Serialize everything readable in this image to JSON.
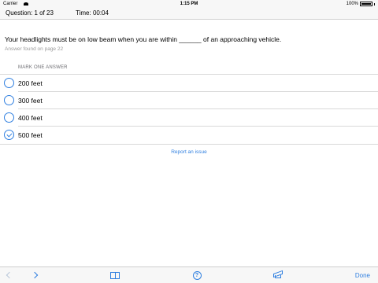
{
  "status_bar": {
    "carrier": "Carrier",
    "time": "1:15 PM",
    "battery": "100%"
  },
  "header": {
    "question_label": "Question:",
    "question_value": "1 of 23",
    "time_label": "Time:",
    "time_value": "00:04"
  },
  "question": {
    "text": "Your headlights must be on low beam when you are within ______ of an approaching vehicle.",
    "answer_found": "Answer found on page 22"
  },
  "answers": {
    "section_label": "MARK ONE ANSWER",
    "options": [
      {
        "label": "200 feet",
        "selected": false
      },
      {
        "label": "300 feet",
        "selected": false
      },
      {
        "label": "400 feet",
        "selected": false
      },
      {
        "label": "500 feet",
        "selected": true
      }
    ]
  },
  "report_link": "Report an issue",
  "toolbar": {
    "done_label": "Done",
    "icons": [
      "chevron-left-icon",
      "chevron-right-icon",
      "book-icon",
      "help-icon",
      "graduation-cap-icon"
    ]
  },
  "colors": {
    "accent": "#2f7fe0",
    "bar_background": "#f7f7f7",
    "separator": "#d9d9d9"
  }
}
